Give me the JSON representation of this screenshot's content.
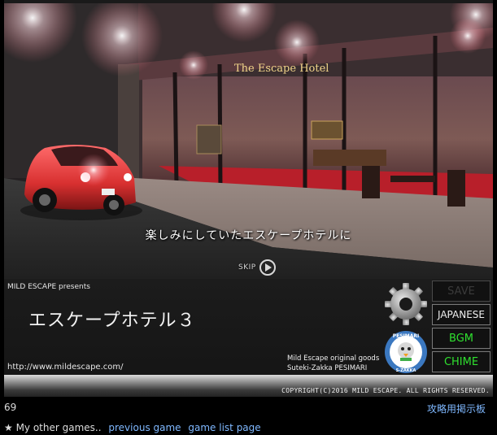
{
  "scene": {
    "sign_text": "The Escape Hotel",
    "subtitle": "楽しみにしていたエスケープホテルに",
    "skip_label": "SKIP"
  },
  "panel": {
    "presents": "MILD ESCAPE presents",
    "title": "エスケープホテル３",
    "url": "http://www.mildescape.com/",
    "goods_line1": "Mild Escape original goods",
    "goods_line2": "Suteki-Zakka PESIMARI",
    "copyright": "COPYRIGHT(C)2016 MILD ESCAPE. ALL RIGHTS RESERVED.",
    "logo_top": "PESIMARI",
    "logo_bottom": "S-ZAKKA"
  },
  "buttons": {
    "save": "SAVE",
    "language": "JAPANESE",
    "bgm": "BGM",
    "chime": "CHIME"
  },
  "footer": {
    "count": "69",
    "board_link": "攻略用掲示板",
    "other_games_label": "★ My other games..",
    "previous_game": "previous game",
    "game_list": "game list page"
  },
  "colors": {
    "toggle_on": "#2fe02f",
    "link": "#7fb8ff",
    "background": "#000000"
  },
  "icons": [
    "gear-icon",
    "skip-play-icon",
    "pesimari-logo"
  ]
}
